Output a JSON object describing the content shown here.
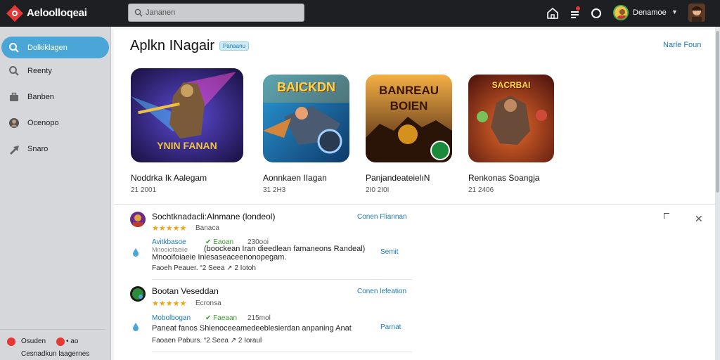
{
  "topbar": {
    "brand": "Aeloolloqeai",
    "brand_sub": "",
    "search_placeholder": "Jananen",
    "user_name": "Denamoe",
    "icons": [
      "logo-icon",
      "home-icon",
      "notification-icon",
      "circle-icon",
      "chevron-down-icon"
    ]
  },
  "sidebar": {
    "items": [
      {
        "label": "Dolkiklagen",
        "icon": "search-icon",
        "active": true
      },
      {
        "label": "Reenty",
        "icon": "search-icon",
        "active": false
      },
      {
        "label": "Banben",
        "icon": "briefcase-icon",
        "active": false
      },
      {
        "label": "Ocenopo",
        "icon": "person-icon",
        "active": false
      },
      {
        "label": "Snaro",
        "icon": "arrow-icon",
        "active": false
      }
    ],
    "footer": {
      "left_label": "Osuden",
      "right_label": "• ao",
      "bottom_text": "Cesnadkun laagernes"
    }
  },
  "main": {
    "title": "Aplkn INagair",
    "pill": "Panaanu",
    "top_link": "Narle Foun",
    "apps": [
      {
        "title": "Noddrka Ik Aalegam",
        "meta": "21 2001",
        "art_text": "YNIN FANAN",
        "accent": "#f0c040"
      },
      {
        "title": "Aonnkaen IIagan",
        "meta": "31 2H3",
        "art_text": "BAICKDN",
        "accent": "#4fc3f7"
      },
      {
        "title": "PanjandeateielıN",
        "meta": "2I0 2I0I",
        "art_text": "BANREAU BOIEN",
        "accent": "#f59a23"
      },
      {
        "title": "Renkonas Soangja",
        "meta": "21 2406",
        "art_text": "SACRBAI",
        "accent": "#e53935"
      }
    ],
    "feed": [
      {
        "name": "Sochtknadacli:Alnmane (londeol)",
        "stars": "★★★★★",
        "rating_label": "Banaca",
        "link": "Conen Fliannan",
        "tag_blue": "Avitkbasoe",
        "tag_green": "✔ Eaoan",
        "tag_gray": "230ooi",
        "line1_prefix": "Mnooiofaeiie",
        "line1": "(boockean Iran dieedlean famaneons Randeal)",
        "line2": "Mnooifoiaeie Iniesaseaceenonopegam.",
        "sub": "Faoeh Peauer. “2 Seea ↗ 2 Iotoh",
        "side_link": "Semit"
      },
      {
        "name": "Bootan Veseddan",
        "stars": "★★★★★",
        "rating_label": "Ecronsa",
        "link": "Conen lefeation",
        "tag_blue": "Mobolbogan",
        "tag_green": "✔ Faeaan",
        "tag_gray": "215mol",
        "line1_prefix": "",
        "line1": "Paneat fanos Shienoceeamedeeblesierdan anpaning Anat",
        "line2": "",
        "sub": "Faoaen Paburs. “2 Seea ↗ 2 Ioraul",
        "side_link": "Parnat"
      }
    ]
  },
  "colors": {
    "accent": "#4aa6d6",
    "link": "#1a7ab5",
    "star": "#f2a30f",
    "badge": "#e53935"
  }
}
